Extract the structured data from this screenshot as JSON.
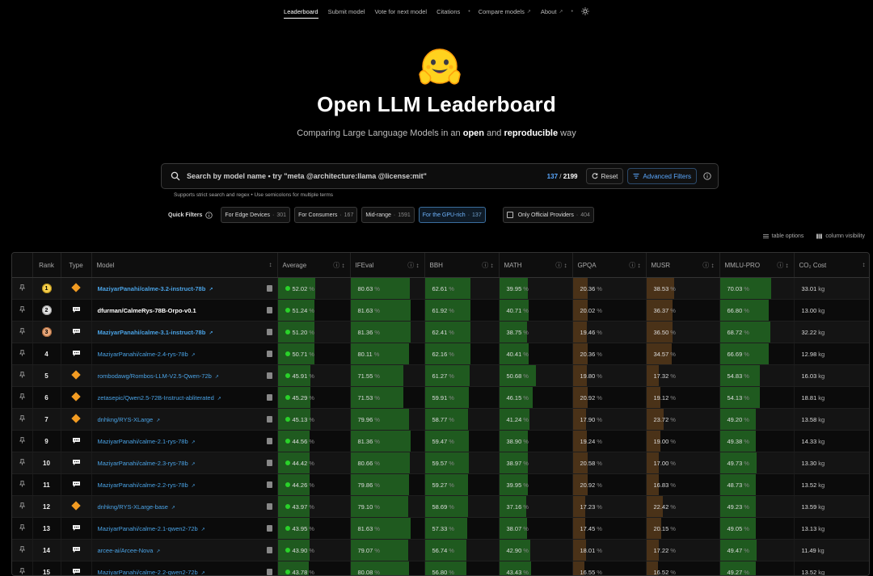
{
  "nav": {
    "items": [
      {
        "label": "Leaderboard",
        "active": true,
        "ext": false
      },
      {
        "label": "Submit model",
        "active": false,
        "ext": false
      },
      {
        "label": "Vote for next model",
        "active": false,
        "ext": false
      },
      {
        "label": "Citations",
        "active": false,
        "ext": false
      },
      {
        "label": "Compare models",
        "active": false,
        "ext": true
      },
      {
        "label": "About",
        "active": false,
        "ext": true
      }
    ],
    "theme_icon": "sun-icon"
  },
  "hero": {
    "logo_icon": "hugging-face-emoji",
    "title": "Open LLM Leaderboard",
    "subtitle_pre": "Comparing Large Language Models in an ",
    "subtitle_b1": "open",
    "subtitle_mid": " and ",
    "subtitle_b2": "reproducible",
    "subtitle_post": " way"
  },
  "search": {
    "placeholder": "Search by model name • try \"meta @architecture:llama @license:mit\"",
    "count_shown": "137",
    "count_sep": " / ",
    "count_total": "2199",
    "reset_label": "Reset",
    "advanced_label": "Advanced Filters",
    "hint": "Supports strict search and regex • Use semicolons for multiple terms"
  },
  "quick_filters": {
    "label": "Quick Filters",
    "chips": [
      {
        "label": "For Edge Devices",
        "count": "301",
        "selected": false
      },
      {
        "label": "For Consumers",
        "count": "167",
        "selected": false
      },
      {
        "label": "Mid-range",
        "count": "1591",
        "selected": false
      },
      {
        "label": "For the GPU-rich",
        "count": "137",
        "selected": true
      }
    ],
    "official": {
      "label": "Only Official Providers",
      "count": "404"
    }
  },
  "tools": {
    "table_options": "table options",
    "column_visibility": "column visibility"
  },
  "table": {
    "headers": [
      "Rank",
      "Type",
      "Model",
      "Average",
      "IFEval",
      "BBH",
      "MATH",
      "GPQA",
      "MUSR",
      "MMLU-PRO",
      "CO₂ Cost"
    ],
    "pct_unit": "%",
    "co2_unit": "kg",
    "rows": [
      {
        "rank": "1",
        "medal": 1,
        "type": "diamond",
        "model": "MaziyarPanahi/calme-3.2-instruct-78b",
        "style": "bold-blue",
        "avg": 52.02,
        "ifeval": 80.63,
        "bbh": 62.61,
        "math": 39.95,
        "gpqa": 20.36,
        "musr": 38.53,
        "mmlu": 70.03,
        "co2": "33.01"
      },
      {
        "rank": "2",
        "medal": 2,
        "type": "chat",
        "model": "dfurman/CalmeRys-78B-Orpo-v0.1",
        "style": "bold-white",
        "avg": 51.24,
        "ifeval": 81.63,
        "bbh": 61.92,
        "math": 40.71,
        "gpqa": 20.02,
        "musr": 36.37,
        "mmlu": 66.8,
        "co2": "13.00"
      },
      {
        "rank": "3",
        "medal": 3,
        "type": "chat",
        "model": "MaziyarPanahi/calme-3.1-instruct-78b",
        "style": "bold-blue",
        "avg": 51.2,
        "ifeval": 81.36,
        "bbh": 62.41,
        "math": 38.75,
        "gpqa": 19.46,
        "musr": 36.5,
        "mmlu": 68.72,
        "co2": "32.22"
      },
      {
        "rank": "4",
        "medal": 0,
        "type": "chat",
        "model": "MaziyarPanahi/calme-2.4-rys-78b",
        "style": "blue",
        "avg": 50.71,
        "ifeval": 80.11,
        "bbh": 62.16,
        "math": 40.41,
        "gpqa": 20.36,
        "musr": 34.57,
        "mmlu": 66.69,
        "co2": "12.98"
      },
      {
        "rank": "5",
        "medal": 0,
        "type": "diamond",
        "model": "rombodawg/Rombos-LLM-V2.5-Qwen-72b",
        "style": "blue",
        "avg": 45.91,
        "ifeval": 71.55,
        "bbh": 61.27,
        "math": 50.68,
        "gpqa": 19.8,
        "musr": 17.32,
        "mmlu": 54.83,
        "co2": "16.03"
      },
      {
        "rank": "6",
        "medal": 0,
        "type": "diamond",
        "model": "zetasepic/Qwen2.5-72B-Instruct-abliterated",
        "style": "blue",
        "avg": 45.29,
        "ifeval": 71.53,
        "bbh": 59.91,
        "math": 46.15,
        "gpqa": 20.92,
        "musr": 19.12,
        "mmlu": 54.13,
        "co2": "18.81"
      },
      {
        "rank": "7",
        "medal": 0,
        "type": "diamond",
        "model": "dnhkng/RYS-XLarge",
        "style": "blue",
        "avg": 45.13,
        "ifeval": 79.96,
        "bbh": 58.77,
        "math": 41.24,
        "gpqa": 17.9,
        "musr": 23.72,
        "mmlu": 49.2,
        "co2": "13.58"
      },
      {
        "rank": "9",
        "medal": 0,
        "type": "chat",
        "model": "MaziyarPanahi/calme-2.1-rys-78b",
        "style": "blue",
        "avg": 44.56,
        "ifeval": 81.36,
        "bbh": 59.47,
        "math": 38.9,
        "gpqa": 19.24,
        "musr": 19.0,
        "mmlu": 49.38,
        "co2": "14.33"
      },
      {
        "rank": "10",
        "medal": 0,
        "type": "chat",
        "model": "MaziyarPanahi/calme-2.3-rys-78b",
        "style": "blue",
        "avg": 44.42,
        "ifeval": 80.66,
        "bbh": 59.57,
        "math": 38.97,
        "gpqa": 20.58,
        "musr": 17.0,
        "mmlu": 49.73,
        "co2": "13.30"
      },
      {
        "rank": "11",
        "medal": 0,
        "type": "chat",
        "model": "MaziyarPanahi/calme-2.2-rys-78b",
        "style": "blue",
        "avg": 44.26,
        "ifeval": 79.86,
        "bbh": 59.27,
        "math": 39.95,
        "gpqa": 20.92,
        "musr": 16.83,
        "mmlu": 48.73,
        "co2": "13.52"
      },
      {
        "rank": "12",
        "medal": 0,
        "type": "diamond",
        "model": "dnhkng/RYS-XLarge-base",
        "style": "blue",
        "avg": 43.97,
        "ifeval": 79.1,
        "bbh": 58.69,
        "math": 37.16,
        "gpqa": 17.23,
        "musr": 22.42,
        "mmlu": 49.23,
        "co2": "13.59"
      },
      {
        "rank": "13",
        "medal": 0,
        "type": "chat",
        "model": "MaziyarPanahi/calme-2.1-qwen2-72b",
        "style": "blue",
        "avg": 43.95,
        "ifeval": 81.63,
        "bbh": 57.33,
        "math": 38.07,
        "gpqa": 17.45,
        "musr": 20.15,
        "mmlu": 49.05,
        "co2": "13.13"
      },
      {
        "rank": "14",
        "medal": 0,
        "type": "chat",
        "model": "arcee-ai/Arcee-Nova",
        "style": "blue",
        "avg": 43.9,
        "ifeval": 79.07,
        "bbh": 56.74,
        "math": 42.9,
        "gpqa": 18.01,
        "musr": 17.22,
        "mmlu": 49.47,
        "co2": "11.49"
      },
      {
        "rank": "15",
        "medal": 0,
        "type": "chat",
        "model": "MaziyarPanahi/calme-2.2-qwen2-72b",
        "style": "blue",
        "avg": 43.78,
        "ifeval": 80.08,
        "bbh": 56.8,
        "math": 43.43,
        "gpqa": 16.55,
        "musr": 16.52,
        "mmlu": 49.27,
        "co2": "13.52"
      }
    ]
  }
}
